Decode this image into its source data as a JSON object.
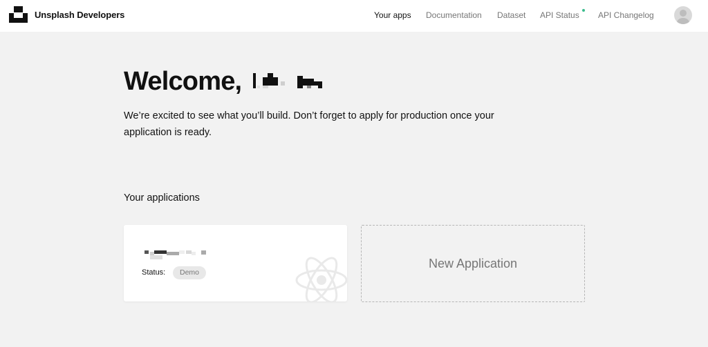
{
  "brand": {
    "name": "Unsplash Developers",
    "logo_icon": "unsplash-logo-icon"
  },
  "nav": {
    "your_apps": "Your apps",
    "documentation": "Documentation",
    "dataset": "Dataset",
    "api_status": "API Status",
    "api_changelog": "API Changelog",
    "status_dot_color": "#3cbc8d",
    "avatar_icon": "user-avatar-icon"
  },
  "welcome": {
    "heading": "Welcome,",
    "intro": "We’re excited to see what you’ll build. Don’t forget to apply for production once your application is ready."
  },
  "applications": {
    "title": "Your applications",
    "cards": [
      {
        "status_label": "Status:",
        "status_badge": "Demo",
        "watermark_icon": "react-icon"
      }
    ],
    "new_app_label": "New Application"
  },
  "colors": {
    "page_bg": "#f2f2f2",
    "text": "#111111",
    "muted": "#767676",
    "badge_bg": "#e8e8e8"
  }
}
